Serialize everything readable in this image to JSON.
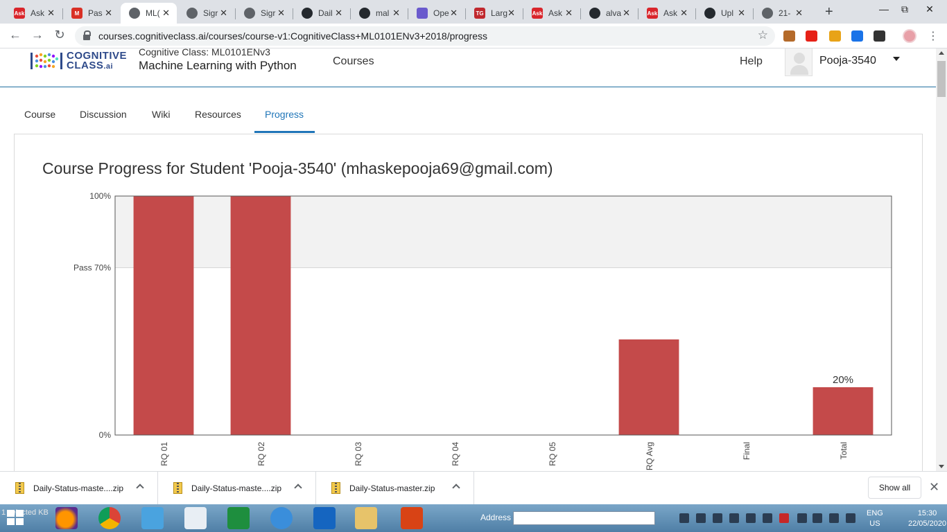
{
  "browser": {
    "tabs": [
      {
        "title": "Ask",
        "icon": "ask-icon",
        "color": "#d9252b",
        "glyph": "Ask",
        "active": false
      },
      {
        "title": "Pas",
        "icon": "gmail-icon",
        "color": "#d93025",
        "glyph": "M",
        "active": false
      },
      {
        "title": "ML(",
        "icon": "globe-icon",
        "color": "#5f6368",
        "glyph": "",
        "active": true
      },
      {
        "title": "Sigr",
        "icon": "globe-icon",
        "color": "#5f6368",
        "glyph": "",
        "active": false
      },
      {
        "title": "Sigr",
        "icon": "globe-icon",
        "color": "#5f6368",
        "glyph": "",
        "active": false
      },
      {
        "title": "Dail",
        "icon": "github-icon",
        "color": "#24292e",
        "glyph": "",
        "active": false
      },
      {
        "title": "mal",
        "icon": "github-icon",
        "color": "#24292e",
        "glyph": "",
        "active": false
      },
      {
        "title": "Ope",
        "icon": "atom-icon",
        "color": "#6a5acd",
        "glyph": "",
        "active": false
      },
      {
        "title": "Larg",
        "icon": "tg-icon",
        "color": "#c0282d",
        "glyph": "TG",
        "active": false
      },
      {
        "title": "Ask",
        "icon": "ask-icon",
        "color": "#d9252b",
        "glyph": "Ask",
        "active": false
      },
      {
        "title": "alva",
        "icon": "github-icon",
        "color": "#24292e",
        "glyph": "",
        "active": false
      },
      {
        "title": "Ask",
        "icon": "ask-icon",
        "color": "#d9252b",
        "glyph": "Ask",
        "active": false
      },
      {
        "title": "Upl",
        "icon": "github-icon",
        "color": "#24292e",
        "glyph": "",
        "active": false
      },
      {
        "title": "21-",
        "icon": "globe-icon",
        "color": "#5f6368",
        "glyph": "",
        "active": false
      }
    ],
    "url": "courses.cognitiveclass.ai/courses/course-v1:CognitiveClass+ML0101ENv3+2018/progress"
  },
  "header": {
    "logo_line1": "COGNITIVE",
    "logo_line2": "CLASS",
    "logo_suffix": ".ai",
    "org_line": "Cognitive Class: ML0101ENv3",
    "course_title": "Machine Learning with Python",
    "courses_link": "Courses",
    "help_link": "Help",
    "username": "Pooja-3540"
  },
  "course_nav": [
    {
      "label": "Course",
      "active": false
    },
    {
      "label": "Discussion",
      "active": false
    },
    {
      "label": "Wiki",
      "active": false
    },
    {
      "label": "Resources",
      "active": false
    },
    {
      "label": "Progress",
      "active": true
    }
  ],
  "progress_heading": "Course Progress for Student 'Pooja-3540' (mhaskepooja69@gmail.com)",
  "chart_data": {
    "type": "bar",
    "categories": [
      "RQ 01",
      "RQ 02",
      "RQ 03",
      "RQ 04",
      "RQ 05",
      "RQ Avg",
      "Final",
      "Total"
    ],
    "values": [
      100,
      100,
      0,
      0,
      0,
      40,
      0,
      20
    ],
    "data_labels": [
      "",
      "",
      "",
      "",
      "",
      "",
      "",
      "20%"
    ],
    "y_tick_labels": [
      "100%",
      "Pass 70%",
      "0%"
    ],
    "y_ticks": [
      100,
      70,
      0
    ],
    "ylim": [
      0,
      100
    ],
    "pass_threshold": 70,
    "bar_color": "#c44a4a",
    "pass_zone_color": "#f2f2f2"
  },
  "downloads": [
    {
      "name": "Daily-Status-maste....zip"
    },
    {
      "name": "Daily-Status-maste....zip"
    },
    {
      "name": "Daily-Status-master.zip"
    }
  ],
  "downloads_show_all": "Show all",
  "taskbar": {
    "status_text": "1 selected  KB",
    "address_label": "Address",
    "lang_line1": "ENG",
    "lang_line2": "US",
    "time": "15:30",
    "date": "22/05/2020"
  }
}
